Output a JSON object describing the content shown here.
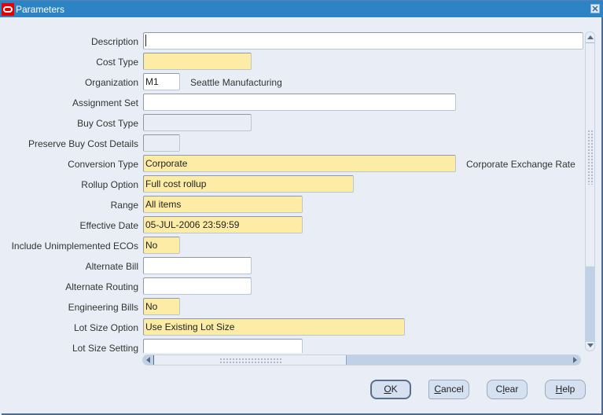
{
  "window": {
    "title": "Parameters",
    "app_icon": "oracle-logo-icon",
    "close_icon": "close-icon"
  },
  "form": {
    "fields": [
      {
        "label": "Description",
        "value": "",
        "state": "optional",
        "focused": true
      },
      {
        "label": "Cost Type",
        "value": "",
        "state": "required"
      },
      {
        "label": "Organization",
        "value": "M1",
        "state": "optional",
        "description": "Seattle Manufacturing"
      },
      {
        "label": "Assignment Set",
        "value": "",
        "state": "optional"
      },
      {
        "label": "Buy Cost Type",
        "value": "",
        "state": "disabled"
      },
      {
        "label": "Preserve Buy Cost Details",
        "value": "",
        "state": "disabled"
      },
      {
        "label": "Conversion Type",
        "value": "Corporate",
        "state": "required",
        "description": "Corporate Exchange Rate"
      },
      {
        "label": "Rollup Option",
        "value": "Full cost rollup",
        "state": "required"
      },
      {
        "label": "Range",
        "value": "All items",
        "state": "required"
      },
      {
        "label": "Effective Date",
        "value": "05-JUL-2006 23:59:59",
        "state": "required"
      },
      {
        "label": "Include Unimplemented ECOs",
        "value": "No",
        "state": "required"
      },
      {
        "label": "Alternate Bill",
        "value": "",
        "state": "optional"
      },
      {
        "label": "Alternate Routing",
        "value": "",
        "state": "optional"
      },
      {
        "label": "Engineering Bills",
        "value": "No",
        "state": "required"
      },
      {
        "label": "Lot Size Option",
        "value": "Use Existing Lot Size",
        "state": "required"
      },
      {
        "label": "Lot Size Setting",
        "value": "",
        "state": "optional"
      }
    ]
  },
  "buttons": {
    "ok": {
      "prefix": "",
      "mnemonic": "O",
      "suffix": "K"
    },
    "cancel": {
      "prefix": "",
      "mnemonic": "C",
      "suffix": "ancel"
    },
    "clear": {
      "prefix": "C",
      "mnemonic": "l",
      "suffix": "ear"
    },
    "help": {
      "prefix": "",
      "mnemonic": "H",
      "suffix": "elp"
    }
  },
  "colors": {
    "title_bar": "#2d84c4",
    "required_field": "#fdeca6",
    "optional_field": "#ffffff",
    "background": "#e9eef6"
  }
}
